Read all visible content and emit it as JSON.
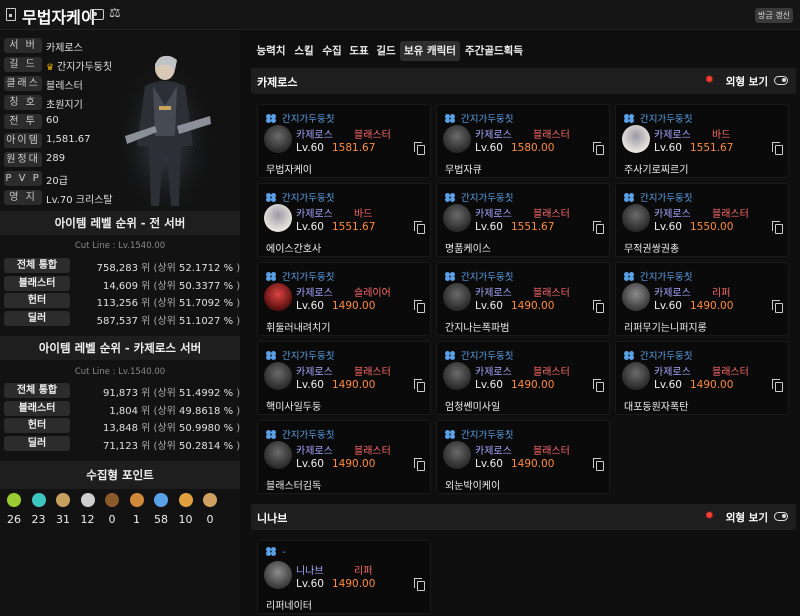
{
  "header": {
    "title": "무법자케이",
    "refresh_label": "갱신",
    "refresh_prefix": "방금 "
  },
  "profile": {
    "rows": [
      {
        "label": "서 버",
        "value": "카제로스"
      },
      {
        "label": "길 드",
        "value": "간지가두둥칫",
        "crown": true
      },
      {
        "label": "클래스",
        "value": "블레스터"
      },
      {
        "label": "칭 호",
        "value": "초원지기"
      },
      {
        "label": "전 투",
        "value": "60"
      },
      {
        "label": "아이템",
        "value": "1,581.67"
      },
      {
        "label": "원정대",
        "value": "289"
      },
      {
        "label": "P V P",
        "value": "20급"
      },
      {
        "label": "영 지",
        "value": "Lv.70 크리스탈"
      }
    ]
  },
  "rank_all": {
    "title": "아이템 레벨 순위 - 전 서버",
    "cutline": "Cut Line : Lv.1540.00",
    "rows": [
      {
        "label": "전체 통합",
        "rank": "758,283",
        "pct": "52.1712 %"
      },
      {
        "label": "블래스터",
        "rank": "14,609",
        "pct": "50.3377 %"
      },
      {
        "label": "헌터",
        "rank": "113,256",
        "pct": "51.7092 %"
      },
      {
        "label": "딜러",
        "rank": "587,537",
        "pct": "51.1027 %"
      }
    ]
  },
  "rank_server": {
    "title": "아이템 레벨 순위 - 카제로스 서버",
    "cutline": "Cut Line : Lv.1540.00",
    "rows": [
      {
        "label": "전체 통합",
        "rank": "91,873",
        "pct": "51.4992 %"
      },
      {
        "label": "블래스터",
        "rank": "1,804",
        "pct": "49.8618 %"
      },
      {
        "label": "헌터",
        "rank": "13,848",
        "pct": "50.9980 %"
      },
      {
        "label": "딜러",
        "rank": "71,123",
        "pct": "50.2814 %"
      }
    ]
  },
  "rank_unit": "위",
  "rank_pct_prefix": "(상위",
  "rank_pct_suffix": ")",
  "collect": {
    "title": "수집형 포인트",
    "items": [
      {
        "icon": "mokoko-seed-icon",
        "count": "26",
        "color": "#9acd32"
      },
      {
        "icon": "island-heart-icon",
        "count": "23",
        "color": "#3ec6c0"
      },
      {
        "icon": "great-art-icon",
        "count": "31",
        "color": "#c8a060"
      },
      {
        "icon": "giant-heart-icon",
        "count": "12",
        "color": "#cfcfcf"
      },
      {
        "icon": "ignea-token-icon",
        "count": "0",
        "color": "#8b5a2b"
      },
      {
        "icon": "sea-bounty-icon",
        "count": "1",
        "color": "#d08a3a"
      },
      {
        "icon": "world-tree-leaf-icon",
        "count": "58",
        "color": "#5aa0e6"
      },
      {
        "icon": "orpheus-star-icon",
        "count": "10",
        "color": "#e0a040"
      },
      {
        "icon": "omnium-star-icon",
        "count": "0",
        "color": "#d0a060"
      }
    ]
  },
  "tabs": [
    {
      "label": "능력치",
      "active": false
    },
    {
      "label": "스킬",
      "active": false
    },
    {
      "label": "수집",
      "active": false
    },
    {
      "label": "도표",
      "active": false
    },
    {
      "label": "길드",
      "active": false
    },
    {
      "label": "보유 캐릭터",
      "active": true
    },
    {
      "label": "주간골드획득",
      "active": false
    }
  ],
  "view_label": "외형 보기",
  "servers": [
    {
      "name": "카제로스",
      "characters": [
        {
          "guild": "간지가두둥칫",
          "server": "카제로스",
          "class": "블래스터",
          "level": "Lv.60",
          "ilvl": "1581.67",
          "name": "무법자케이",
          "avatar": "dark"
        },
        {
          "guild": "간지가두둥칫",
          "server": "카제로스",
          "class": "블래스터",
          "level": "Lv.60",
          "ilvl": "1580.00",
          "name": "무법자큐",
          "avatar": "dark"
        },
        {
          "guild": "간지가두둥칫",
          "server": "카제로스",
          "class": "바드",
          "level": "Lv.60",
          "ilvl": "1551.67",
          "name": "주사기로찌르기",
          "avatar": "light"
        },
        {
          "guild": "간지가두둥칫",
          "server": "카제로스",
          "class": "바드",
          "level": "Lv.60",
          "ilvl": "1551.67",
          "name": "에이스간호사",
          "avatar": "light"
        },
        {
          "guild": "간지가두둥칫",
          "server": "카제로스",
          "class": "블래스터",
          "level": "Lv.60",
          "ilvl": "1551.67",
          "name": "명품케이스",
          "avatar": "dark"
        },
        {
          "guild": "간지가두둥칫",
          "server": "카제로스",
          "class": "블래스터",
          "level": "Lv.60",
          "ilvl": "1550.00",
          "name": "무적권쌍권총",
          "avatar": "dark"
        },
        {
          "guild": "간지가두둥칫",
          "server": "카제로스",
          "class": "슬레이어",
          "level": "Lv.60",
          "ilvl": "1490.00",
          "name": "휘둘러내려치기",
          "avatar": "red"
        },
        {
          "guild": "간지가두둥칫",
          "server": "카제로스",
          "class": "블래스터",
          "level": "Lv.60",
          "ilvl": "1490.00",
          "name": "간지나는폭파범",
          "avatar": "dark"
        },
        {
          "guild": "간지가두둥칫",
          "server": "카제로스",
          "class": "리퍼",
          "level": "Lv.60",
          "ilvl": "1490.00",
          "name": "리퍼무기는니퍼지롱",
          "avatar": "gray"
        },
        {
          "guild": "간지가두둥칫",
          "server": "카제로스",
          "class": "블래스터",
          "level": "Lv.60",
          "ilvl": "1490.00",
          "name": "핵미사일두둥",
          "avatar": "dark"
        },
        {
          "guild": "간지가두둥칫",
          "server": "카제로스",
          "class": "블래스터",
          "level": "Lv.60",
          "ilvl": "1490.00",
          "name": "엄청쎈미사일",
          "avatar": "dark"
        },
        {
          "guild": "간지가두둥칫",
          "server": "카제로스",
          "class": "블래스터",
          "level": "Lv.60",
          "ilvl": "1490.00",
          "name": "대포동원자폭탄",
          "avatar": "dark"
        },
        {
          "guild": "간지가두둥칫",
          "server": "카제로스",
          "class": "블래스터",
          "level": "Lv.60",
          "ilvl": "1490.00",
          "name": "블래스터김독",
          "avatar": "dark"
        },
        {
          "guild": "간지가두둥칫",
          "server": "카제로스",
          "class": "블래스터",
          "level": "Lv.60",
          "ilvl": "1490.00",
          "name": "외눈박이케이",
          "avatar": "dark"
        }
      ]
    },
    {
      "name": "니나브",
      "characters": [
        {
          "guild": "-",
          "server": "니나브",
          "class": "리퍼",
          "level": "Lv.60",
          "ilvl": "1490.00",
          "name": "리퍼네이터",
          "avatar": "gray"
        }
      ]
    }
  ]
}
